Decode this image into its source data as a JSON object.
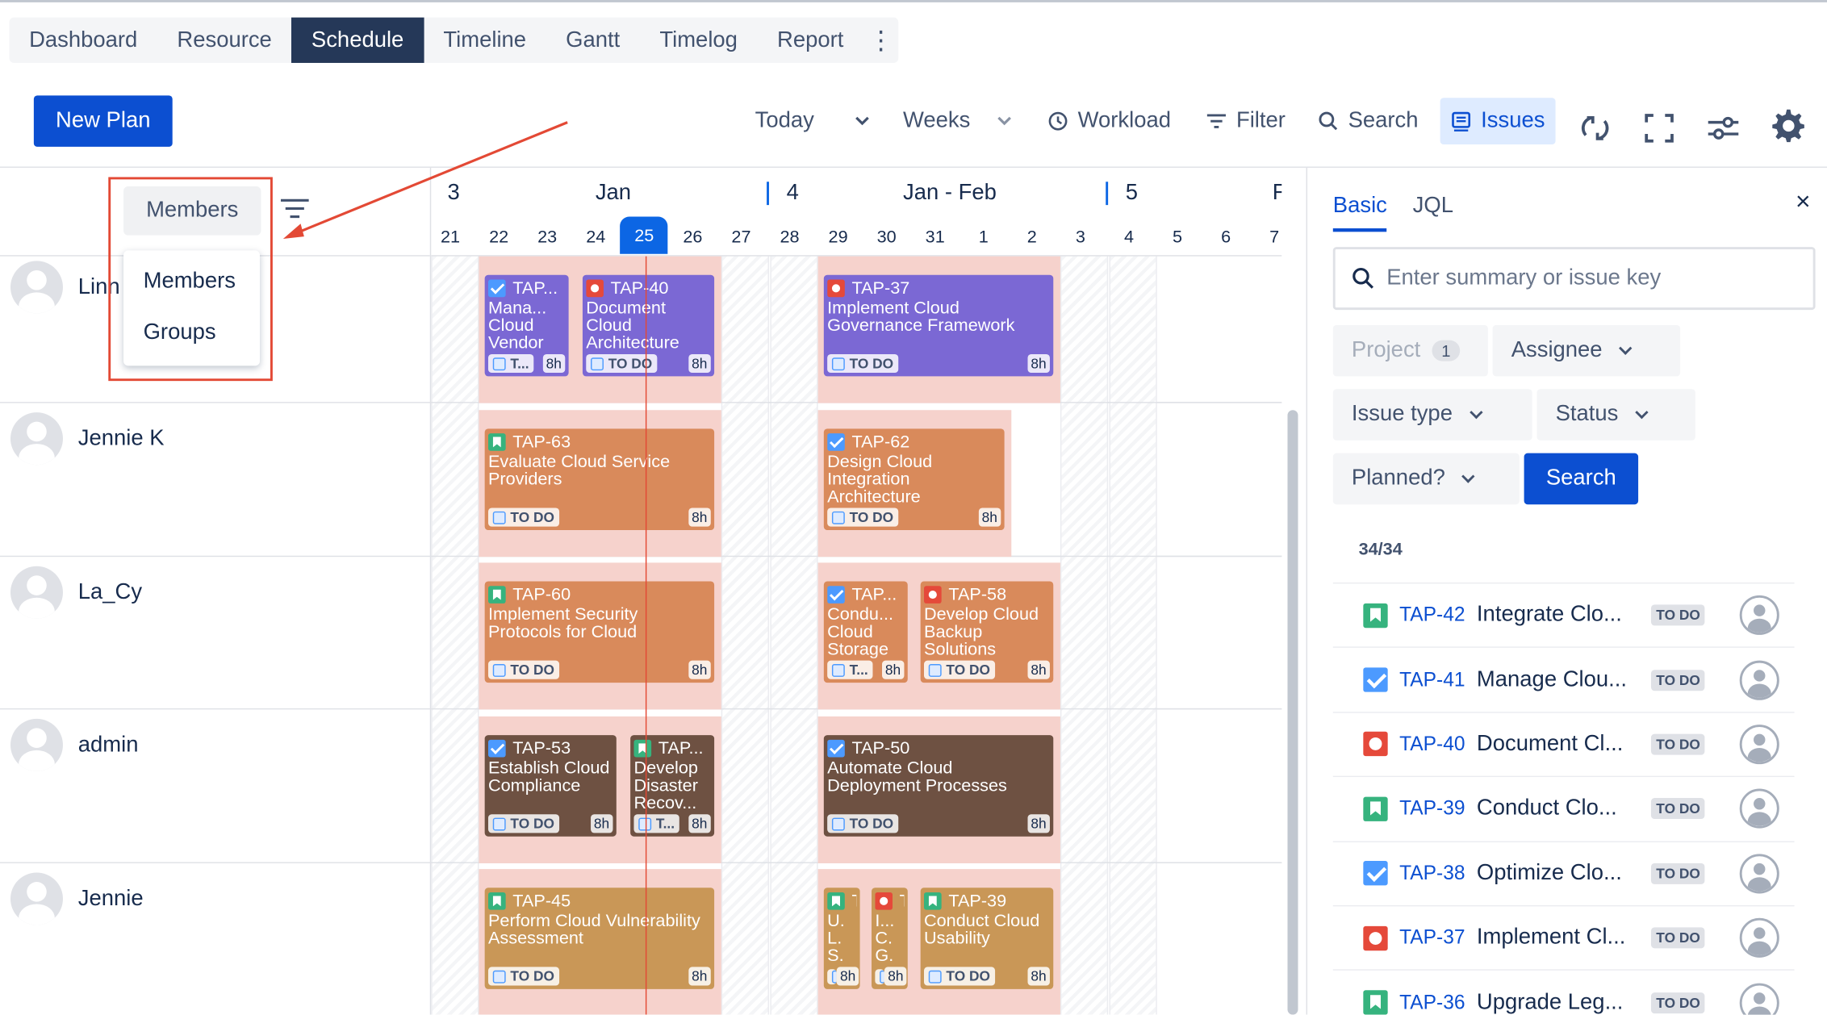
{
  "nav": {
    "tabs": [
      "Dashboard",
      "Resource",
      "Schedule",
      "Timeline",
      "Gantt",
      "Timelog",
      "Report"
    ],
    "active": "Schedule",
    "more_glyph": "⋮"
  },
  "toolbar": {
    "new_plan": "New Plan",
    "today": "Today",
    "weeks": "Weeks",
    "workload": "Workload",
    "filter": "Filter",
    "search": "Search",
    "issues": "Issues"
  },
  "left": {
    "group_by": "Members",
    "dropdown": [
      "Members",
      "Groups"
    ],
    "people": [
      "Linn",
      "Jennie K",
      "La_Cy",
      "admin",
      "Jennie"
    ]
  },
  "timeline": {
    "weeks": [
      {
        "num": "3",
        "label": "Jan"
      },
      {
        "num": "4",
        "label": "Jan - Feb"
      },
      {
        "num": "5",
        "label": ""
      },
      {
        "num": "F",
        "label": ""
      }
    ],
    "days": [
      "21",
      "22",
      "23",
      "24",
      "25",
      "26",
      "27",
      "28",
      "29",
      "30",
      "31",
      "1",
      "2",
      "3",
      "4",
      "5",
      "6",
      "7"
    ],
    "today": "25"
  },
  "cards": [
    {
      "key": "TAP...",
      "summary": "Mana... Cloud Vendor",
      "type": "task",
      "status": "T...",
      "est": "8h",
      "color": "purple"
    },
    {
      "key": "TAP-40",
      "summary": "Document Cloud Architecture",
      "type": "bug",
      "status": "TO DO",
      "est": "8h",
      "color": "purple"
    },
    {
      "key": "TAP-37",
      "summary": "Implement Cloud Governance Framework",
      "type": "bug",
      "status": "TO DO",
      "est": "8h",
      "color": "purple"
    },
    {
      "key": "TAP-63",
      "summary": "Evaluate Cloud Service Providers",
      "type": "story",
      "status": "TO DO",
      "est": "8h",
      "color": "orange"
    },
    {
      "key": "TAP-62",
      "summary": "Design Cloud Integration Architecture",
      "type": "task",
      "status": "TO DO",
      "est": "8h",
      "color": "orange"
    },
    {
      "key": "TAP-60",
      "summary": "Implement Security Protocols for Cloud",
      "type": "story",
      "status": "TO DO",
      "est": "8h",
      "color": "orange"
    },
    {
      "key": "TAP...",
      "summary": "Condu... Cloud Storage",
      "type": "task",
      "status": "T...",
      "est": "8h",
      "color": "orange"
    },
    {
      "key": "TAP-58",
      "summary": "Develop Cloud Backup Solutions",
      "type": "bug",
      "status": "TO DO",
      "est": "8h",
      "color": "orange"
    },
    {
      "key": "TAP-53",
      "summary": "Establish Cloud Compliance",
      "type": "task",
      "status": "TO DO",
      "est": "8h",
      "color": "brown"
    },
    {
      "key": "TAP...",
      "summary": "Develop Disaster Recov...",
      "type": "story",
      "status": "T...",
      "est": "8h",
      "color": "brown"
    },
    {
      "key": "TAP-50",
      "summary": "Automate Cloud Deployment Processes",
      "type": "task",
      "status": "TO DO",
      "est": "8h",
      "color": "brown"
    },
    {
      "key": "TAP-45",
      "summary": "Perform Cloud Vulnerability Assessment",
      "type": "story",
      "status": "TO DO",
      "est": "8h",
      "color": "tan"
    },
    {
      "key": "T...",
      "summary": "U. L. S.",
      "type": "story",
      "status": "",
      "est": "8h",
      "color": "tan"
    },
    {
      "key": "T...",
      "summary": "I... C. G.",
      "type": "bug",
      "status": "",
      "est": "8h",
      "color": "tan"
    },
    {
      "key": "TAP-39",
      "summary": "Conduct Cloud Usability",
      "type": "story",
      "status": "TO DO",
      "est": "8h",
      "color": "tan"
    }
  ],
  "right": {
    "tabs": [
      "Basic",
      "JQL"
    ],
    "close": "×",
    "search_placeholder": "Enter summary or issue key",
    "filters": {
      "project": "Project",
      "project_count": "1",
      "assignee": "Assignee",
      "issue_type": "Issue type",
      "status": "Status",
      "planned": "Planned?"
    },
    "search_button": "Search",
    "count": "34/34",
    "issues": [
      {
        "type": "story",
        "key": "TAP-42",
        "summary": "Integrate Clo...",
        "status": "TO DO"
      },
      {
        "type": "task",
        "key": "TAP-41",
        "summary": "Manage Clou...",
        "status": "TO DO"
      },
      {
        "type": "bug",
        "key": "TAP-40",
        "summary": "Document Cl...",
        "status": "TO DO"
      },
      {
        "type": "story",
        "key": "TAP-39",
        "summary": "Conduct Clo...",
        "status": "TO DO"
      },
      {
        "type": "task",
        "key": "TAP-38",
        "summary": "Optimize Clo...",
        "status": "TO DO"
      },
      {
        "type": "bug",
        "key": "TAP-37",
        "summary": "Implement Cl...",
        "status": "TO DO"
      },
      {
        "type": "story",
        "key": "TAP-36",
        "summary": "Upgrade Leg...",
        "status": "TO DO"
      }
    ]
  },
  "colors": {
    "accent": "#0c4fd1",
    "nav_active": "#253858",
    "highlight": "#e34935"
  }
}
